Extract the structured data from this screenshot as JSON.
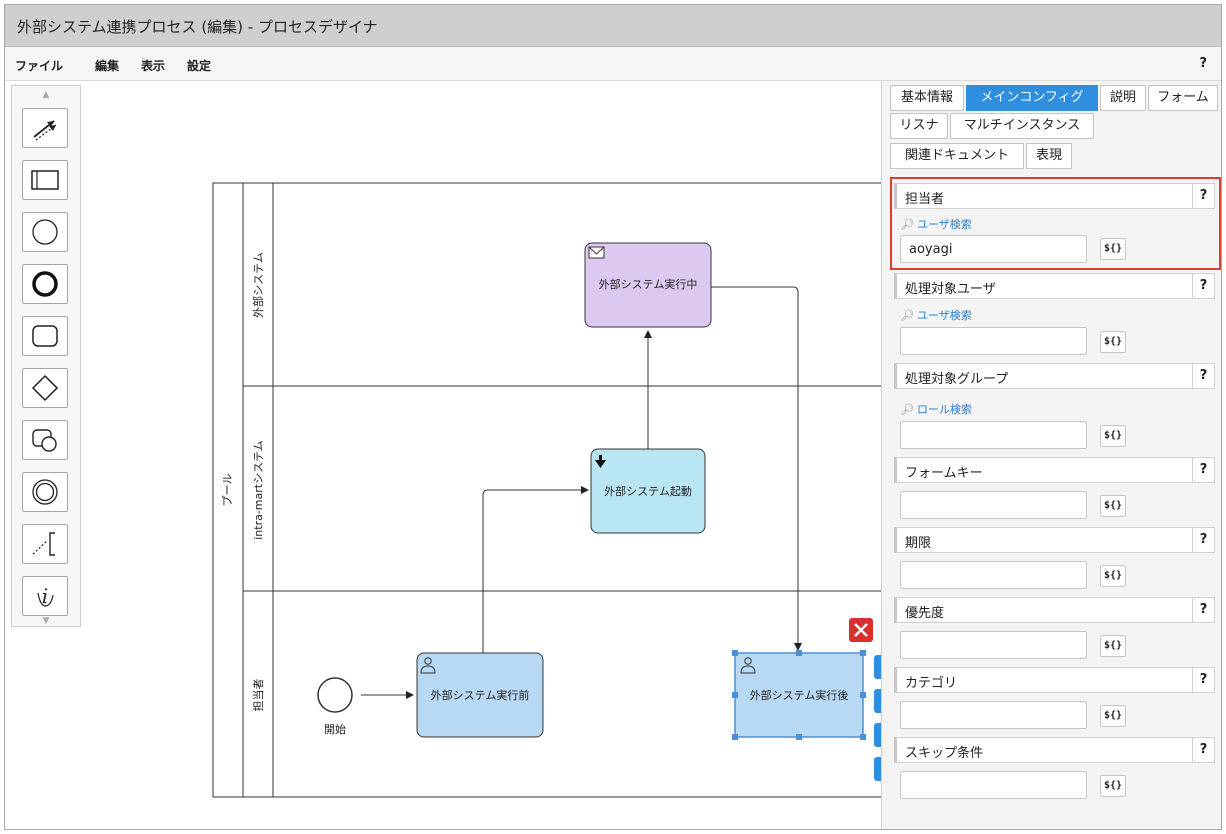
{
  "window": {
    "title": "外部システム連携プロセス (編集) - プロセスデザイナ"
  },
  "menu": {
    "items": [
      "ファイル",
      "編集",
      "表示",
      "設定"
    ],
    "help": "?"
  },
  "palette": {
    "scroll_up": "▲",
    "scroll_down": "▼",
    "tools": [
      "connector-icon",
      "lane-icon",
      "start-event-icon",
      "end-event-icon",
      "task-icon",
      "gateway-icon",
      "subprocess-icon",
      "intermediate-event-icon",
      "annotation-icon",
      "data-object-icon"
    ]
  },
  "diagram": {
    "pool_label": "プール",
    "lanes": [
      "外部システム",
      "intra-martシステム",
      "担当者"
    ],
    "start_label": "開始",
    "tasks": {
      "external_running": "外部システム実行中",
      "external_start": "外部システム起動",
      "before": "外部システム実行前",
      "after": "外部システム実行後"
    },
    "delete_icon": "✕"
  },
  "panel": {
    "tabs": {
      "basic": "基本情報",
      "main": "メインコンフィグ",
      "desc": "説明",
      "form": "フォーム",
      "listener": "リスナ",
      "multi": "マルチインスタンス",
      "docs": "関連ドキュメント",
      "expr": "表現"
    },
    "help": "?",
    "expr_button": "${}",
    "sections": {
      "assignee": {
        "label": "担当者",
        "link": "ユーザ検索",
        "value": "aoyagi"
      },
      "candidate_users": {
        "label": "処理対象ユーザ",
        "link": "ユーザ検索",
        "value": ""
      },
      "candidate_groups": {
        "label": "処理対象グループ",
        "link": "ロール検索",
        "value": ""
      },
      "form_key": {
        "label": "フォームキー",
        "value": ""
      },
      "due": {
        "label": "期限",
        "value": ""
      },
      "priority": {
        "label": "優先度",
        "value": ""
      },
      "category": {
        "label": "カテゴリ",
        "value": ""
      },
      "skip": {
        "label": "スキップ条件",
        "value": ""
      }
    }
  },
  "colors": {
    "accent": "#2e8ee0",
    "highlight": "#d9402e",
    "task_blue": "#b8d9f3",
    "task_cyan": "#b9e6f3",
    "task_purple": "#ddc9ef"
  }
}
